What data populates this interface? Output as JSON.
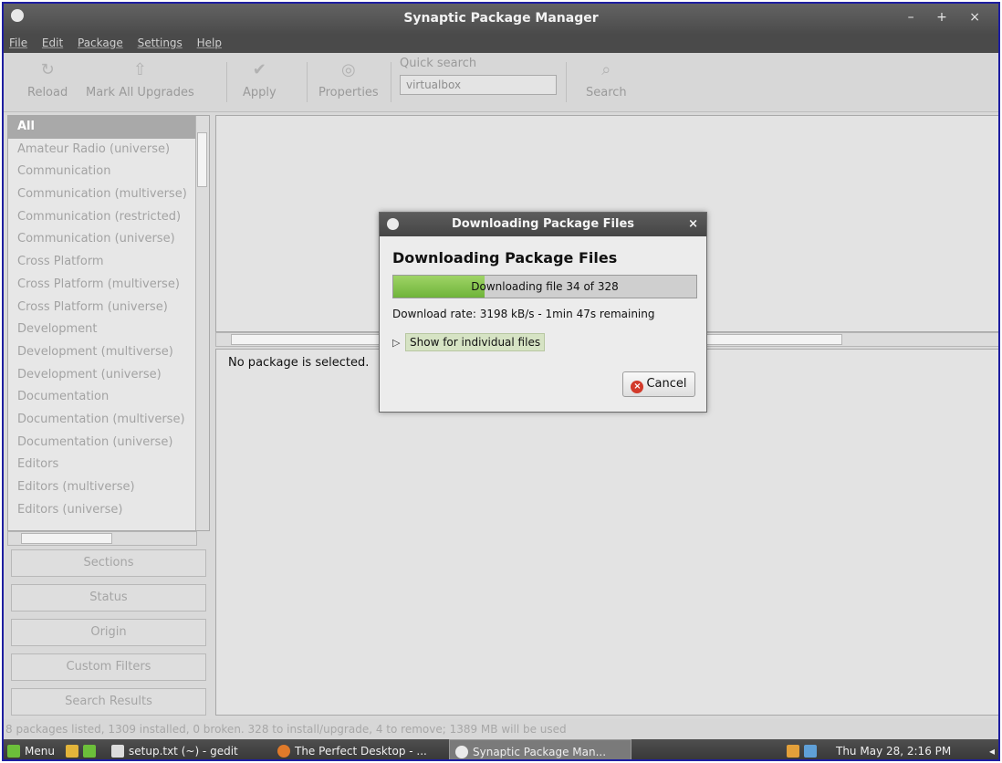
{
  "window": {
    "title": "Synaptic Package Manager",
    "controls": "– + ×"
  },
  "menubar": {
    "items": [
      "File",
      "Edit",
      "Package",
      "Settings",
      "Help"
    ]
  },
  "toolbar": {
    "reload": "Reload",
    "mark_all_upgrades": "Mark All Upgrades",
    "apply": "Apply",
    "properties": "Properties",
    "quick_search_label": "Quick search",
    "quick_search_value": "virtualbox",
    "search": "Search"
  },
  "sidebar": {
    "categories": [
      "All",
      "Amateur Radio (universe)",
      "Communication",
      "Communication (multiverse)",
      "Communication (restricted)",
      "Communication (universe)",
      "Cross Platform",
      "Cross Platform (multiverse)",
      "Cross Platform (universe)",
      "Development",
      "Development (multiverse)",
      "Development (universe)",
      "Documentation",
      "Documentation (multiverse)",
      "Documentation (universe)",
      "Editors",
      "Editors (multiverse)",
      "Editors (universe)"
    ],
    "selected_index": 0,
    "filter_buttons": [
      "Sections",
      "Status",
      "Origin",
      "Custom Filters",
      "Search Results"
    ]
  },
  "details": {
    "no_package": "No package is selected."
  },
  "dialog": {
    "title": "Downloading Package Files",
    "close": "×",
    "heading": "Downloading Package Files",
    "progress_text": "Downloading file 34 of 328",
    "progress_fraction": 0.3,
    "rate_text": "Download rate: 3198 kB/s - 1min 47s remaining",
    "expander_arrow": "▷",
    "expander_label": "Show for individual files",
    "cancel_label": "Cancel"
  },
  "statusbar": {
    "text": "8 packages listed, 1309 installed, 0 broken. 328 to install/upgrade, 4 to remove; 1389 MB will be used"
  },
  "taskbar": {
    "menu": "Menu",
    "tasks": [
      {
        "label": "setup.txt (~) - gedit",
        "active": false
      },
      {
        "label": "The Perfect Desktop - ...",
        "active": false
      },
      {
        "label": "Synaptic Package Man...",
        "active": true
      }
    ],
    "clock": "Thu May 28,  2:16 PM"
  },
  "colors": {
    "titlebar": "#4a4a4a",
    "progress_fill": "#7fc24a",
    "cancel_icon": "#d23a2a"
  }
}
